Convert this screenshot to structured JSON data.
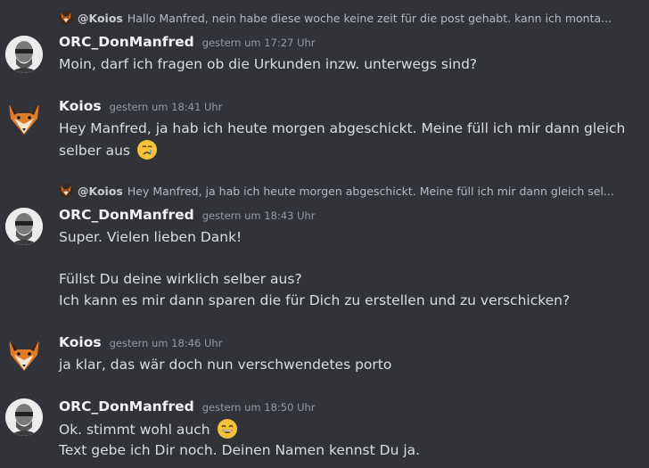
{
  "messages": [
    {
      "reply": {
        "name": "@Koios",
        "text": "Hallo Manfred, nein habe diese woche keine zeit für die post gehabt. kann ich monta..."
      },
      "author": "ORC_DonManfred",
      "time": "gestern um 17:27 Uhr",
      "lines": [
        "Moin, darf ich fragen ob die Urkunden inzw. unterwegs sind?"
      ]
    },
    {
      "author": "Koios",
      "time": "gestern um 18:41 Uhr",
      "lines": [
        "Hey Manfred, ja hab ich heute morgen abgeschickt. Meine füll ich mir dann gleich",
        "selber aus"
      ],
      "emoji": "crying-face"
    },
    {
      "reply": {
        "name": "@Koios",
        "text": "Hey Manfred, ja hab ich heute morgen abgeschickt. Meine füll ich mir dann gleich sel..."
      },
      "author": "ORC_DonManfred",
      "time": "gestern um 18:43 Uhr",
      "lines": [
        "Super. Vielen lieben Dank!",
        "",
        "Füllst Du deine wirklich selber aus?",
        "Ich kann es mir dann sparen die für Dich zu erstellen und zu verschicken?"
      ]
    },
    {
      "author": "Koios",
      "time": "gestern um 18:46 Uhr",
      "lines": [
        "ja klar, das wär doch nun verschwendetes porto"
      ]
    },
    {
      "author": "ORC_DonManfred",
      "time": "gestern um 18:50 Uhr",
      "lines": [
        "Ok. stimmt wohl auch",
        "Text gebe ich Dir noch. Deinen Namen kennst Du ja."
      ],
      "emoji": "grinning-face"
    }
  ],
  "colors": {
    "background": "#313338",
    "text": "#dbdee1",
    "username": "#f2f3f5",
    "timestamp": "#949ba4"
  }
}
